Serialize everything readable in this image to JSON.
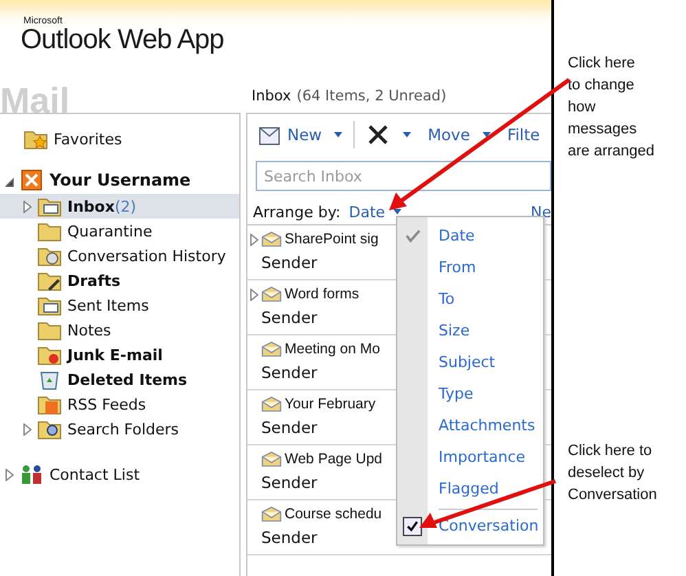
{
  "logo": {
    "vendor": "Microsoft",
    "product": "Outlook Web App"
  },
  "section_title": "Mail",
  "nav": {
    "favorites": "Favorites",
    "account": {
      "name": "Your Username",
      "expanded": true
    },
    "folders": [
      {
        "name": "Inbox",
        "count": "(2)",
        "bold": true,
        "selected": true,
        "expandable": true,
        "kind": "inbox"
      },
      {
        "name": "Quarantine",
        "bold": false,
        "selected": false,
        "expandable": false,
        "kind": "folder"
      },
      {
        "name": "Conversation History",
        "bold": false,
        "selected": false,
        "expandable": false,
        "kind": "history"
      },
      {
        "name": "Drafts",
        "bold": true,
        "selected": false,
        "expandable": false,
        "kind": "drafts"
      },
      {
        "name": "Sent Items",
        "bold": false,
        "selected": false,
        "expandable": false,
        "kind": "sent"
      },
      {
        "name": "Notes",
        "bold": false,
        "selected": false,
        "expandable": false,
        "kind": "notes"
      },
      {
        "name": "Junk E-mail",
        "bold": true,
        "selected": false,
        "expandable": false,
        "kind": "junk"
      },
      {
        "name": "Deleted Items",
        "bold": true,
        "selected": false,
        "expandable": false,
        "kind": "trash"
      },
      {
        "name": "RSS Feeds",
        "bold": false,
        "selected": false,
        "expandable": false,
        "kind": "rss"
      },
      {
        "name": "Search Folders",
        "bold": false,
        "selected": false,
        "expandable": true,
        "kind": "search"
      }
    ],
    "contact_list": {
      "label": "Contact List",
      "expanded": false
    }
  },
  "list_header": {
    "folder": "Inbox",
    "summary": "(64 Items,  2 Unread)"
  },
  "toolbar": [
    {
      "kind": "new",
      "label": "New"
    },
    {
      "kind": "delete"
    },
    {
      "kind": "move",
      "label": "Move"
    },
    {
      "kind": "text",
      "label": "Filte"
    }
  ],
  "search": {
    "placeholder": "Search Inbox"
  },
  "arrange": {
    "label": "Arrange by:",
    "value": "Date",
    "right_link": "Ne"
  },
  "messages": [
    {
      "subject": "SharePoint sig",
      "sender": "Sender",
      "expandable": true
    },
    {
      "subject": "Word forms",
      "sender": "Sender",
      "expandable": true
    },
    {
      "subject": "Meeting on Mo",
      "sender": "Sender",
      "expandable": false
    },
    {
      "subject": "Your February",
      "sender": "Sender",
      "expandable": false
    },
    {
      "subject": "Web Page Upd",
      "sender": "Sender",
      "expandable": false
    },
    {
      "subject": "Course schedu",
      "sender": "Sender",
      "expandable": false
    }
  ],
  "arrange_menu": [
    {
      "kind": "sort",
      "label": "Date",
      "selected": true
    },
    {
      "kind": "sort",
      "label": "From",
      "selected": false
    },
    {
      "kind": "sort",
      "label": "To",
      "selected": false
    },
    {
      "kind": "sort",
      "label": "Size",
      "selected": false
    },
    {
      "kind": "sort",
      "label": "Subject",
      "selected": false
    },
    {
      "kind": "sort",
      "label": "Type",
      "selected": false
    },
    {
      "kind": "sort",
      "label": "Attachments",
      "selected": false
    },
    {
      "kind": "sort",
      "label": "Importance",
      "selected": false
    },
    {
      "kind": "sort",
      "label": "Flagged",
      "selected": false
    },
    {
      "kind": "toggle",
      "label": "Conversation",
      "checked": true
    }
  ],
  "annotations": [
    {
      "text": "Click here\nto change\nhow\nmessages\nare arranged"
    },
    {
      "text": "Click here to\ndeselect by\nConversation"
    }
  ]
}
